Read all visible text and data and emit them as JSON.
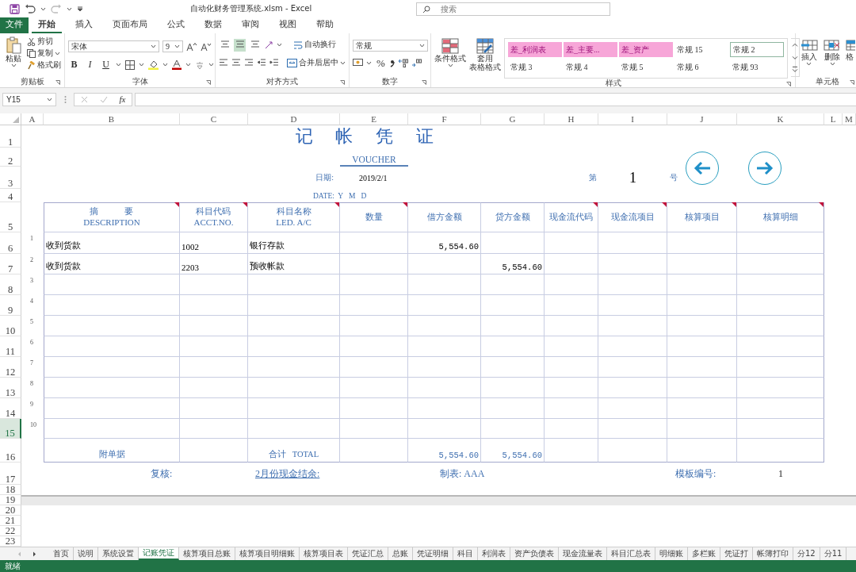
{
  "window": {
    "title": "自动化财务管理系统.xlsm  -  Excel",
    "search_placeholder": "搜索"
  },
  "ribbon": {
    "tabs": [
      {
        "label": "文件",
        "kind": "file",
        "selected": false
      },
      {
        "label": "开始",
        "kind": "tab",
        "selected": true
      },
      {
        "label": "插入",
        "kind": "tab",
        "selected": false
      },
      {
        "label": "页面布局",
        "kind": "tab",
        "selected": false
      },
      {
        "label": "公式",
        "kind": "tab",
        "selected": false
      },
      {
        "label": "数据",
        "kind": "tab",
        "selected": false
      },
      {
        "label": "审阅",
        "kind": "tab",
        "selected": false
      },
      {
        "label": "视图",
        "kind": "tab",
        "selected": false
      },
      {
        "label": "帮助",
        "kind": "tab",
        "selected": false
      }
    ],
    "clipboard": {
      "title": "剪贴板",
      "paste": "粘贴",
      "cut": "剪切",
      "copy": "复制",
      "painter": "格式刷"
    },
    "font": {
      "title": "字体",
      "name": "宋体",
      "size": "9",
      "bold": "B",
      "italic": "I",
      "underline": "U"
    },
    "alignment": {
      "title": "对齐方式",
      "wrap": "自动换行",
      "merge": "合并后居中",
      "vertical": [
        {
          "selected": false
        },
        {
          "selected": true
        },
        {
          "selected": false
        }
      ]
    },
    "number": {
      "title": "数字",
      "format": "常规",
      "percent": "%"
    },
    "styles": {
      "title": "样式",
      "conditional": "条件格式",
      "table_format": [
        "套用",
        "表格格式"
      ],
      "gallery": [
        {
          "label": "差_利润表",
          "kind": "bad",
          "selected": false
        },
        {
          "label": "差_主要...",
          "kind": "bad",
          "selected": false
        },
        {
          "label": "差_资产",
          "kind": "bad",
          "selected": false
        },
        {
          "label": "常规 15",
          "kind": "normal",
          "selected": false
        },
        {
          "label": "常规 2",
          "kind": "normal",
          "selected": true
        },
        {
          "label": "常规 3",
          "kind": "normal",
          "selected": false
        },
        {
          "label": "常规 4",
          "kind": "normal",
          "selected": false
        },
        {
          "label": "常规 5",
          "kind": "normal",
          "selected": false
        },
        {
          "label": "常规 6",
          "kind": "normal",
          "selected": false
        },
        {
          "label": "常规 93",
          "kind": "normal",
          "selected": false
        }
      ]
    },
    "cells": {
      "title": "单元格",
      "insert": "插入",
      "delete": "删除",
      "format": "格"
    }
  },
  "formula_bar": {
    "name_box": "Y15",
    "function": "fx"
  },
  "sheet": {
    "columns": [
      "A",
      "B",
      "C",
      "D",
      "E",
      "F",
      "G",
      "H",
      "I",
      "J",
      "K",
      "L",
      "M"
    ],
    "rows": [
      {
        "label": "1",
        "selected": false
      },
      {
        "label": "2",
        "selected": false
      },
      {
        "label": "3",
        "selected": false
      },
      {
        "label": "4",
        "selected": false
      },
      {
        "label": "5",
        "selected": false
      },
      {
        "label": "6",
        "selected": false
      },
      {
        "label": "7",
        "selected": false
      },
      {
        "label": "8",
        "selected": false
      },
      {
        "label": "9",
        "selected": false
      },
      {
        "label": "10",
        "selected": false
      },
      {
        "label": "11",
        "selected": false
      },
      {
        "label": "12",
        "selected": false
      },
      {
        "label": "13",
        "selected": false
      },
      {
        "label": "14",
        "selected": false
      },
      {
        "label": "15",
        "selected": true
      },
      {
        "label": "16",
        "selected": false
      },
      {
        "label": "17",
        "selected": false
      },
      {
        "label": "18",
        "selected": false
      },
      {
        "label": "19",
        "selected": false
      },
      {
        "label": "20",
        "selected": false
      },
      {
        "label": "21",
        "selected": false
      },
      {
        "label": "22",
        "selected": false
      },
      {
        "label": "23",
        "selected": false
      }
    ]
  },
  "voucher": {
    "title": "记 帐 凭 证",
    "subtitle": "VOUCHER",
    "date_label": "日期:",
    "date": "2019/2/1",
    "date_parts": "DATE:  Y   M   D",
    "number_prefix": "第",
    "number": "1",
    "number_suffix": "号",
    "columns": [
      {
        "label": "摘　　　要",
        "en": "DESCRIPTION",
        "comment": true
      },
      {
        "label": "科目代码",
        "en": "ACCT.NO.",
        "comment": true
      },
      {
        "label": "科目名称",
        "en": "LED. A/C",
        "comment": true
      },
      {
        "label": "数量",
        "comment": true
      },
      {
        "label": "借方金额",
        "comment": false
      },
      {
        "label": "贷方金额",
        "comment": false
      },
      {
        "label": "现金流代码",
        "comment": true
      },
      {
        "label": "现金流项目",
        "comment": true
      },
      {
        "label": "核算项目",
        "comment": true
      },
      {
        "label": "核算明细",
        "comment": true
      }
    ],
    "entries": [
      {
        "no": "1",
        "description": "收到货款",
        "code": "1002",
        "account": "银行存款",
        "debit": "5,554.60"
      },
      {
        "no": "2",
        "description": "收到货款",
        "code": "2203",
        "account": "预收帐款",
        "credit": "5,554.60"
      },
      {
        "no": "3"
      },
      {
        "no": "4"
      },
      {
        "no": "5"
      },
      {
        "no": "6"
      },
      {
        "no": "7"
      },
      {
        "no": "8"
      },
      {
        "no": "9"
      },
      {
        "no": "10"
      }
    ],
    "total": {
      "attachments": "附单据",
      "label": "合计   TOTAL",
      "debit": "5,554.60",
      "credit": "5,554.60"
    },
    "footer": {
      "review": "复核:",
      "balance": "2月份现金结余:",
      "maker": "制表: AAA",
      "template_label": "模板编号:",
      "template": "1"
    }
  },
  "sheet_tabs": [
    {
      "label": "首页",
      "selected": false
    },
    {
      "label": "说明",
      "selected": false
    },
    {
      "label": "系统设置",
      "selected": false
    },
    {
      "label": "记账凭证",
      "selected": true
    },
    {
      "label": "核算项目总账",
      "selected": false
    },
    {
      "label": "核算项目明细账",
      "selected": false
    },
    {
      "label": "核算项目表",
      "selected": false
    },
    {
      "label": "凭证汇总",
      "selected": false
    },
    {
      "label": "总账",
      "selected": false
    },
    {
      "label": "凭证明细",
      "selected": false
    },
    {
      "label": "科目",
      "selected": false
    },
    {
      "label": "利润表",
      "selected": false
    },
    {
      "label": "资产负债表",
      "selected": false
    },
    {
      "label": "现金流量表",
      "selected": false
    },
    {
      "label": "科目汇总表",
      "selected": false
    },
    {
      "label": "明细账",
      "selected": false
    },
    {
      "label": "多栏账",
      "selected": false
    },
    {
      "label": "凭证打",
      "selected": false
    },
    {
      "label": "帐簿打印",
      "selected": false
    },
    {
      "label": "分12",
      "selected": false
    },
    {
      "label": "分11",
      "selected": false
    }
  ],
  "status_bar": {
    "text": "就绪"
  }
}
